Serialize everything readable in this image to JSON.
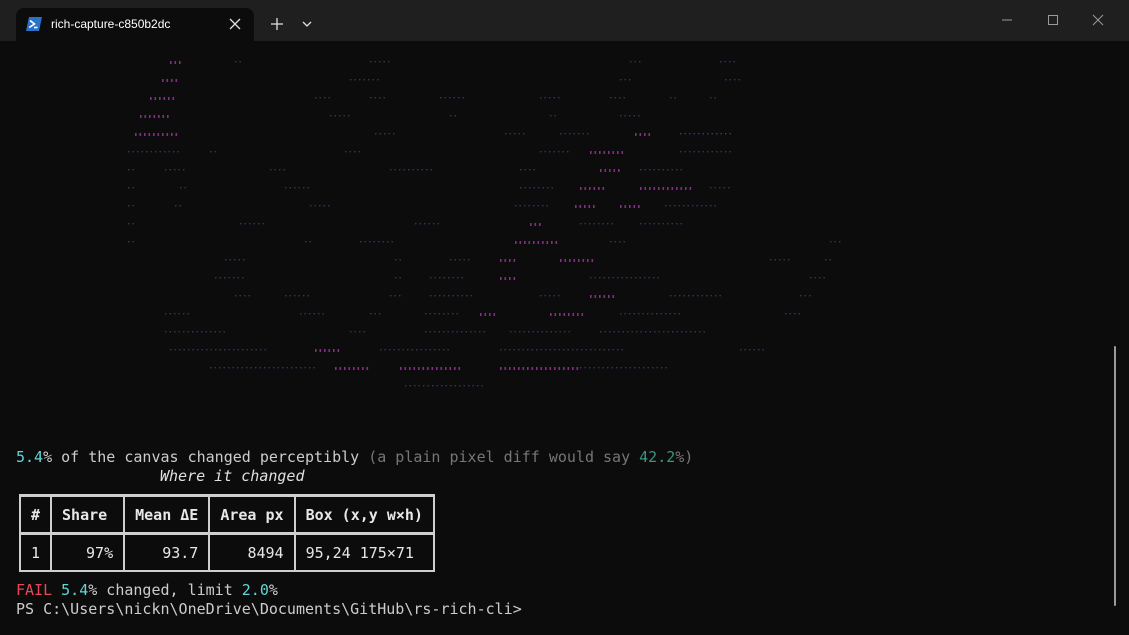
{
  "window": {
    "tab_title": "rich-capture-c850b2dc",
    "icons": {
      "tab": "powershell-icon",
      "close": "close-icon",
      "new_tab": "plus-icon",
      "dropdown": "chevron-down-icon",
      "minimize": "minimize-icon",
      "maximize": "maximize-icon",
      "window_close": "close-icon"
    }
  },
  "summary": {
    "percent": "5.4",
    "percent_sign": "%",
    "text": " of the canvas changed perceptibly ",
    "paren_prefix": "(a plain pixel diff would say ",
    "pixel_percent": "42.2",
    "paren_suffix": "%)"
  },
  "table": {
    "title": "Where it changed",
    "headers": [
      "#",
      "Share",
      "Mean ΔE",
      "Area px",
      "Box (x,y w×h)"
    ],
    "rows": [
      [
        "1",
        "97%",
        "93.7",
        "8494",
        "95,24 175×71"
      ]
    ]
  },
  "result": {
    "status": "FAIL",
    "percent": "5.4",
    "middle": "% changed, limit ",
    "limit": "2.0",
    "end": "%"
  },
  "prompt": {
    "text": "PS C:\\Users\\nickn\\OneDrive\\Documents\\GitHub\\rs-rich-cli>"
  },
  "colors": {
    "background": "#0c0c0c",
    "titlebar": "#1f1f1f",
    "cyan": "#61d6d6",
    "teal": "#3a9683",
    "fail_red": "#e74856",
    "art_dim": "#3d2f6a",
    "art_bright": "#8a2a8a"
  }
}
